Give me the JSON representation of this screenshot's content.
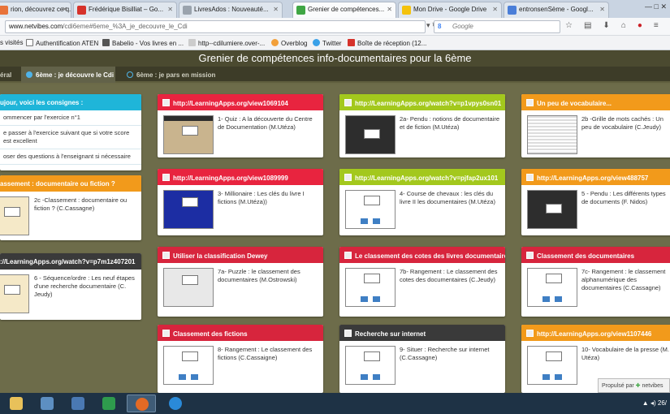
{
  "browser": {
    "tabs": [
      {
        "label": "rion, découvrez ce q...",
        "color": "#e8733a",
        "active": false
      },
      {
        "label": "Frédérique Bisilliat – Go...",
        "color": "#d6322b",
        "active": false
      },
      {
        "label": "LivresAdos : Nouveauté...",
        "color": "#9aa3ad",
        "active": false
      },
      {
        "label": "Grenier de compétences...",
        "color": "#3fa644",
        "active": true
      },
      {
        "label": "Mon Drive - Google Drive",
        "color": "#f4c20d",
        "active": false
      },
      {
        "label": "entronsenSème - Googl...",
        "color": "#4a7ed8",
        "active": false
      }
    ],
    "url_host": "www.netvibes.com",
    "url_path": "/cdi6eme#6eme_%3A_je_decouvre_le_Cdi",
    "search_placeholder": "Google",
    "search_engine_letter": "8",
    "window_controls": "—  □  ✕"
  },
  "bookmarks": [
    {
      "label": "s visités",
      "icon_color": ""
    },
    {
      "label": "Authentification ATEN",
      "icon_color": "#ffffff"
    },
    {
      "label": "Babelio - Vos livres en ...",
      "icon_color": "#555555"
    },
    {
      "label": "http--cdilumiere.over-...",
      "icon_color": "#cccccc"
    },
    {
      "label": "Overblog",
      "icon_color": "#f2a03a"
    },
    {
      "label": "Twitter",
      "icon_color": "#3aa1e8"
    },
    {
      "label": "Boîte de réception (12...",
      "icon_color": "#d6322b"
    }
  ],
  "page": {
    "title": "Grenier de compétences info-documentaires pour la 6ème",
    "tabs": [
      {
        "label": "éral",
        "active": false,
        "pin": ""
      },
      {
        "label": "6ème : je découvre le Cdi",
        "active": true,
        "pin": "#4fb3e8"
      },
      {
        "label": "6ème : je pars en mission",
        "active": false,
        "pin": "#4fb3e8"
      }
    ]
  },
  "colors": {
    "cyan": "#1fb5d9",
    "orange": "#f29a1b",
    "dark": "#3a3a3a",
    "red": "#e8243f",
    "lime": "#a3c81d",
    "crimson": "#d7253d"
  },
  "consignes": {
    "header": "ujour, voici les consignes :",
    "rows": [
      "ommencer par l'exercice n°1",
      "e passer à l'exercice suivant que si votre score est excellent",
      "oser des questions à l'enseignant si nécessaire"
    ]
  },
  "widgets": {
    "w2c": {
      "header": "assement : documentaire ou fiction ?",
      "desc": "2c -Classement : documentaire ou fiction ? (C.Cassagne)"
    },
    "w6": {
      "header": "://LearningApps.org/watch?v=p7m1z407201",
      "desc": "6 - Séquence/ordre : Les neuf étapes d'une recherche documentaire (C. Jeudy)"
    },
    "w1": {
      "header": "http://LearningApps.org/view1069104",
      "desc": "1- Quiz : A la découverte du Centre de Documentation (M.Utéza)"
    },
    "w2a": {
      "header": "http://LearningApps.org/watch?v=p1vpys0sn01",
      "desc": "2a- Pendu : notions de documentaire et de fiction (M.Utéza)"
    },
    "w2b": {
      "header": "Un peu de vocabulaire...",
      "desc": "2b -Grille de mots cachés : Un peu de vocabulaire (C.Jeudy)"
    },
    "w3": {
      "header": "http://LearningApps.org/view1089999",
      "desc": "3- Millionaire : Les clés du livre I fictions (M.Utéza))"
    },
    "w4": {
      "header": "http://LearningApps.org/watch?v=pjfap2ux101",
      "desc": "4- Course de chevaux : les clés du livre II les documentaires (M.Utéza)"
    },
    "w5": {
      "header": "http://LearningApps.org/view488757",
      "desc": "5 - Pendu : Les différents types de documents (F. Nidos)"
    },
    "w7a": {
      "header": "Utiliser la classification Dewey",
      "desc": "7a- Puzzle : le classement des documentaires (M.Ostrowski)"
    },
    "w7b": {
      "header": "Le classement des cotes des livres documentaires",
      "desc": "7b- Rangement : Le classement des cotes des documentaires (C.Jeudy)"
    },
    "w7c": {
      "header": "Classement des documentaires",
      "desc": "7c- Rangement : le classement alphanumérique des documentaires (C.Cassagne)"
    },
    "w8": {
      "header": "Classement des fictions",
      "desc": "8- Rangement : Le classement des fictions (C.Cassaigne)"
    },
    "w9": {
      "header": "Recherche sur internet",
      "desc": "9- Situer : Recherche sur internet (C.Cassagne)"
    },
    "w10": {
      "header": "http://LearningApps.org/view1107446",
      "desc": "10- Vocabulaire de la presse (M. Utéza)"
    }
  },
  "popup": {
    "text": "Propulsé par",
    "brand": "netvibes"
  },
  "taskbar": {
    "apps": [
      "file-explorer-icon",
      "search-network-icon",
      "remote-desktop-icon",
      "store-icon",
      "firefox-icon",
      "ie-icon"
    ],
    "tray_arrow": "▲",
    "clock": "26/"
  }
}
